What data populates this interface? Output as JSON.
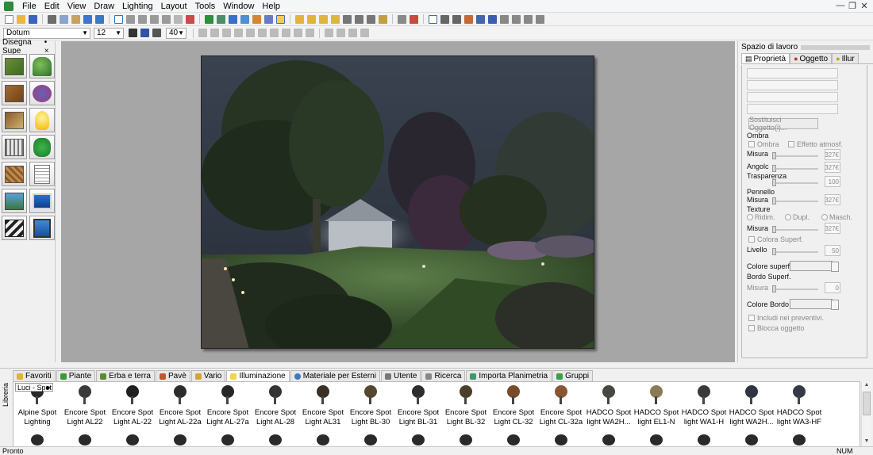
{
  "menu": {
    "items": [
      "File",
      "Edit",
      "View",
      "Draw",
      "Lighting",
      "Layout",
      "Tools",
      "Window",
      "Help"
    ]
  },
  "window_controls": {
    "minimize": "—",
    "restore": "❐",
    "close": "✕"
  },
  "format_bar": {
    "font_name": "Dotum",
    "font_size": "12",
    "size_value": "40"
  },
  "left_panel": {
    "title": "Disegna Supe",
    "pin": "•",
    "close": "×"
  },
  "right_panel": {
    "title": "Spazio di lavoro",
    "tabs": [
      "Proprietà",
      "Oggetto",
      "Illur"
    ],
    "replace_button": "Sostituisci Oggetto(i)...",
    "shadow_heading": "Ombra",
    "shadow_check": "Ombra",
    "atmos_check": "Effetto atmosf.",
    "size_label": "Misura",
    "size_value": "-327€",
    "angle_label": "Angolc",
    "angle_value": "-327€",
    "transparency_heading": "Trasparenza",
    "transparency_value": "100",
    "brush_heading": "Pennello",
    "brush_size_label": "Misura",
    "brush_size_value": "-327€",
    "texture_heading": "Texture",
    "radio_scale": "Ridim.",
    "radio_dupl": "Dupl.",
    "radio_masch": "Masch.",
    "texture_size_label": "Misura",
    "texture_size_value": "-327€",
    "surface_color_check": "Colora Superf.",
    "level_label": "Livello",
    "level_value": "50",
    "surface_color_label": "Colore superf.",
    "surface_border_heading": "Bordo Superf.",
    "border_size_label": "Misura",
    "border_size_value": "0",
    "border_color_label": "Colore Bordo",
    "include_estimates": "Includi nei preventivi.",
    "lock_object": "Blocca oggetto"
  },
  "library": {
    "side_label": "Libreria",
    "filter": "Luci - Spot",
    "tabs": [
      "Favoriti",
      "Piante",
      "Erba e terra",
      "Pavè",
      "Vario",
      "Illuminazione",
      "Materiale per Esterni",
      "Utente",
      "Ricerca",
      "Importa Planimetria",
      "Gruppi"
    ],
    "active_tab": "Illuminazione",
    "items": [
      {
        "line1": "Alpine Spot",
        "line2": "Lighting"
      },
      {
        "line1": "Encore Spot",
        "line2": "Light AL22"
      },
      {
        "line1": "Encore Spot",
        "line2": "Light AL-22"
      },
      {
        "line1": "Encore Spot",
        "line2": "Light AL-22a"
      },
      {
        "line1": "Encore Spot",
        "line2": "Light AL-27a"
      },
      {
        "line1": "Encore Spot",
        "line2": "Light AL-28"
      },
      {
        "line1": "Encore Spot",
        "line2": "Light AL31"
      },
      {
        "line1": "Encore Spot",
        "line2": "Light BL-30"
      },
      {
        "line1": "Encore Spot",
        "line2": "Light BL-31"
      },
      {
        "line1": "Encore Spot",
        "line2": "Light BL-32"
      },
      {
        "line1": "Encore Spot",
        "line2": "Light CL-32"
      },
      {
        "line1": "Encore Spot",
        "line2": "Light CL-32a"
      },
      {
        "line1": "HADCO Spot",
        "line2": "light  WA2H..."
      },
      {
        "line1": "HADCO Spot",
        "line2": "light EL1-N"
      },
      {
        "line1": "HADCO Spot",
        "line2": "light WA1-H"
      },
      {
        "line1": "HADCO Spot",
        "line2": "light WA2H..."
      },
      {
        "line1": "HADCO Spot",
        "line2": "light WA3-HF"
      }
    ]
  },
  "status": {
    "left": "Pronto",
    "right": "NUM"
  },
  "colors": {
    "canvas_bg": "#a6a6a6",
    "night_sky": "#2b333f",
    "lawn": "#3d5a2c"
  }
}
